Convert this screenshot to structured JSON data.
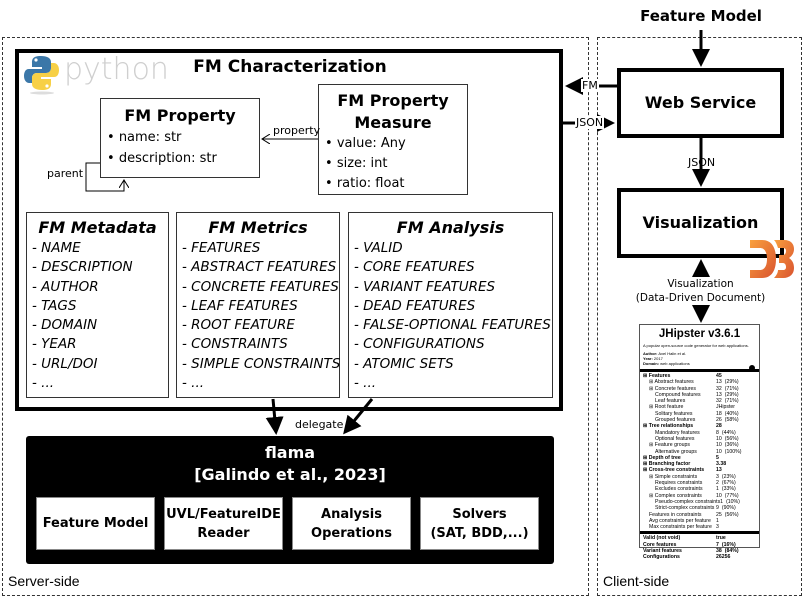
{
  "server_side": {
    "label": "Server-side",
    "python_logo_text": "python",
    "characterization": {
      "title": "FM Characterization",
      "fm_property": {
        "title": "FM Property",
        "attributes": [
          "name: str",
          "description: str"
        ],
        "self_relation_label": "parent"
      },
      "fm_property_measure": {
        "title_line1": "FM Property",
        "title_line2": "Measure",
        "attributes": [
          "value: Any",
          "size: int",
          "ratio: float"
        ],
        "relation_label": "property"
      },
      "categories": [
        {
          "title": "FM Metadata",
          "items": [
            "- NAME",
            "- DESCRIPTION",
            "- AUTHOR",
            "- TAGS",
            "- DOMAIN",
            "- YEAR",
            "- URL/DOI",
            "- ..."
          ]
        },
        {
          "title": "FM Metrics",
          "items": [
            "- FEATURES",
            "- ABSTRACT FEATURES",
            "- CONCRETE FEATURES",
            "- LEAF FEATURES",
            "- ROOT FEATURE",
            "- CONSTRAINTS",
            "- SIMPLE CONSTRAINTS",
            "- ..."
          ]
        },
        {
          "title": "FM Analysis",
          "items": [
            "- VALID",
            "- CORE FEATURES",
            "- VARIANT FEATURES",
            "- DEAD FEATURES",
            "- FALSE-OPTIONAL FEATURES",
            "- CONFIGURATIONS",
            "- ATOMIC SETS",
            "- ..."
          ]
        }
      ]
    },
    "delegate_label": "delegate",
    "flama": {
      "title": "flama",
      "citation": "[Galindo et al., 2023]",
      "components": [
        {
          "line1": "Feature Model",
          "line2": ""
        },
        {
          "line1": "UVL/FeatureIDE",
          "line2": "Reader"
        },
        {
          "line1": "Analysis",
          "line2": "Operations"
        },
        {
          "line1": "Solvers",
          "line2": "(SAT, BDD,...)"
        }
      ]
    }
  },
  "client_side": {
    "label": "Client-side",
    "input_label": "Feature Model",
    "web_service": "Web Service",
    "fm_arrow_label": "FM",
    "json_arrow_label": "JSON",
    "json_down_label": "JSON",
    "visualization": "Visualization",
    "d3_logo_text": "D3",
    "vis_label_line1": "Visualization",
    "vis_label_line2": "(Data-Driven Document)",
    "report": {
      "title": "JHipster v3.6.1",
      "description": "A popular open-source code generator for web applications.",
      "author_label": "Author:",
      "author": "Axel Halin et al.",
      "year_label": "Year:",
      "year": "2017",
      "domain_label": "Domain:",
      "domain": "web applications",
      "rows": [
        {
          "label": "⊞ Features",
          "value": "45",
          "pct": "",
          "indent": 0,
          "bold": true
        },
        {
          "label": "⊞ Abstract features",
          "value": "13",
          "pct": "(29%)",
          "indent": 1,
          "bold": false
        },
        {
          "label": "⊞ Concrete features",
          "value": "32",
          "pct": "(71%)",
          "indent": 1,
          "bold": false
        },
        {
          "label": "Compound features",
          "value": "13",
          "pct": "(29%)",
          "indent": 2,
          "bold": false
        },
        {
          "label": "Leaf features",
          "value": "32",
          "pct": "(71%)",
          "indent": 2,
          "bold": false
        },
        {
          "label": "⊞ Root feature",
          "value": "JHipster",
          "pct": "",
          "indent": 1,
          "bold": false
        },
        {
          "label": "Solitary features",
          "value": "18",
          "pct": "(40%)",
          "indent": 2,
          "bold": false
        },
        {
          "label": "Grouped features",
          "value": "26",
          "pct": "(58%)",
          "indent": 2,
          "bold": false
        },
        {
          "label": "⊞ Tree relationships",
          "value": "28",
          "pct": "",
          "indent": 0,
          "bold": true
        },
        {
          "label": "Mandatory features",
          "value": "8",
          "pct": "(44%)",
          "indent": 2,
          "bold": false
        },
        {
          "label": "Optional features",
          "value": "10",
          "pct": "(56%)",
          "indent": 2,
          "bold": false
        },
        {
          "label": "⊞ Feature groups",
          "value": "10",
          "pct": "(36%)",
          "indent": 1,
          "bold": false
        },
        {
          "label": "Alternative groups",
          "value": "10",
          "pct": "(100%)",
          "indent": 2,
          "bold": false
        },
        {
          "label": "⊞ Depth of tree",
          "value": "5",
          "pct": "",
          "indent": 0,
          "bold": true
        },
        {
          "label": "⊞ Branching factor",
          "value": "3.38",
          "pct": "",
          "indent": 0,
          "bold": true
        },
        {
          "label": "⊞ Cross-tree constraints",
          "value": "13",
          "pct": "",
          "indent": 0,
          "bold": true
        },
        {
          "label": "⊞ Simple constraints",
          "value": "3",
          "pct": "(23%)",
          "indent": 1,
          "bold": false
        },
        {
          "label": "Requires constraints",
          "value": "2",
          "pct": "(67%)",
          "indent": 2,
          "bold": false
        },
        {
          "label": "Excludes constraints",
          "value": "1",
          "pct": "(33%)",
          "indent": 2,
          "bold": false
        },
        {
          "label": "⊞ Complex constraints",
          "value": "10",
          "pct": "(77%)",
          "indent": 1,
          "bold": false
        },
        {
          "label": "Pseudo-complex constraints",
          "value": "1",
          "pct": "(10%)",
          "indent": 2,
          "bold": false
        },
        {
          "label": "Strict-complex constraints",
          "value": "9",
          "pct": "(90%)",
          "indent": 2,
          "bold": false
        },
        {
          "label": "Features in constraints",
          "value": "25",
          "pct": "(56%)",
          "indent": 1,
          "bold": false
        },
        {
          "label": "Avg constraints per feature",
          "value": "1",
          "pct": "",
          "indent": 1,
          "bold": false
        },
        {
          "label": "Max constraints per feature",
          "value": "3",
          "pct": "",
          "indent": 1,
          "bold": false
        }
      ],
      "analysis_rows": [
        {
          "label": "Valid (not void)",
          "value": "true",
          "pct": ""
        },
        {
          "label": "Core features",
          "value": "7",
          "pct": "(16%)"
        },
        {
          "label": "Variant features",
          "value": "38",
          "pct": "(84%)"
        },
        {
          "label": "Configurations",
          "value": "26256",
          "pct": ""
        }
      ]
    }
  },
  "colors": {
    "python_blue": "#3b77a8",
    "python_yellow": "#f7d046",
    "d3_orange": "#f29b38",
    "d3_red": "#e0603a"
  }
}
